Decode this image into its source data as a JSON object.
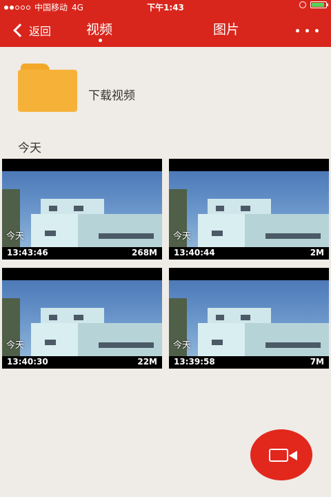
{
  "status_bar": {
    "carrier": "中国移动",
    "network": "4G",
    "time": "下午1:43"
  },
  "nav": {
    "back_label": "返回",
    "tabs": [
      {
        "label": "视频",
        "active": true
      },
      {
        "label": "图片",
        "active": false
      }
    ]
  },
  "folder": {
    "label": "下载视频"
  },
  "section": {
    "title": "今天"
  },
  "videos": [
    {
      "watermark": "今天",
      "time": "13:43:46",
      "size": "268M"
    },
    {
      "watermark": "今天",
      "time": "13:40:44",
      "size": "2M"
    },
    {
      "watermark": "今天",
      "time": "13:40:30",
      "size": "22M"
    },
    {
      "watermark": "今天",
      "time": "13:39:58",
      "size": "7M"
    }
  ],
  "colors": {
    "accent": "#d9261c",
    "background": "#efebe6",
    "folder": "#f6b238",
    "battery": "#5ad05a"
  },
  "icons": {
    "back": "chevron-left-icon",
    "more": "more-dots-icon",
    "folder": "folder-icon",
    "record": "video-camera-icon"
  }
}
